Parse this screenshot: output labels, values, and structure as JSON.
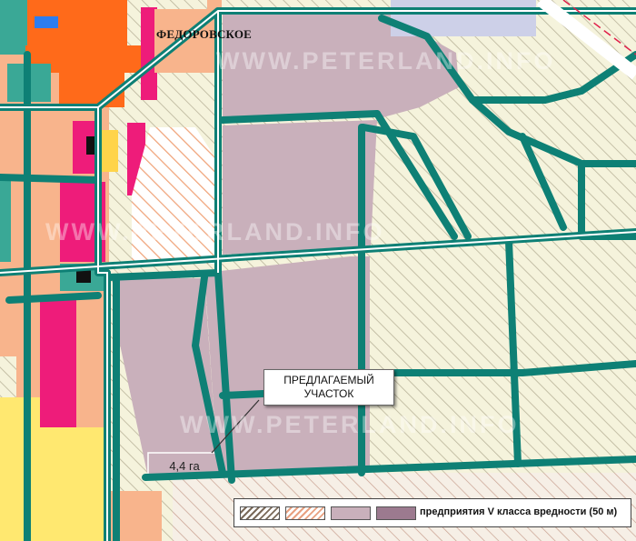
{
  "map": {
    "place_name": "ФЕДОРОВСКОЕ",
    "watermark": "WWW.PETERLAND.INFO",
    "callout": {
      "line1": "ПРЕДЛАГАЕМЫЙ",
      "line2": "УЧАСТОК"
    },
    "area_label": "4,4 га",
    "legend": {
      "text": "предприятия V класса вредности (50 м)",
      "swatches": [
        {
          "pattern": "hatched",
          "color": "#7a6a5a"
        },
        {
          "pattern": "hatched",
          "color": "#e8a080"
        },
        {
          "pattern": "solid",
          "color": "#c9b0bb"
        },
        {
          "pattern": "solid",
          "color": "#9c7a8f"
        }
      ]
    },
    "colors": {
      "industrial_zone": "#c9b0bb",
      "road": "#0e8075",
      "residential_hatch": "#f4f2da",
      "public_orange": "#ff6a1a",
      "magenta": "#ee1c7a",
      "peach": "#f8b48c",
      "yellow": "#ffe870"
    }
  }
}
